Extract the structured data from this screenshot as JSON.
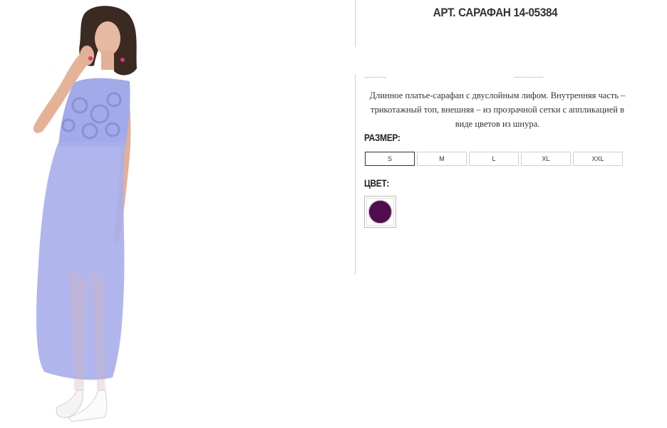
{
  "product": {
    "title": "АРТ. САРАФАН 14-05384",
    "description": "Длинное платье-сарафан с двуслойным лифом. Внутренняя часть – трикотажный топ, внешняя – из прозрачной сетки с аппликацией в виде цветов из шнура."
  },
  "size_section": {
    "label": "РАЗМЕР:",
    "options": [
      "S",
      "M",
      "L",
      "XL",
      "XXL"
    ],
    "selected": "S"
  },
  "color_section": {
    "label": "ЦВЕТ:",
    "swatches": [
      {
        "color": "#4f0d4f"
      }
    ]
  },
  "photo": {
    "dress_color": "#a9b0ec"
  }
}
